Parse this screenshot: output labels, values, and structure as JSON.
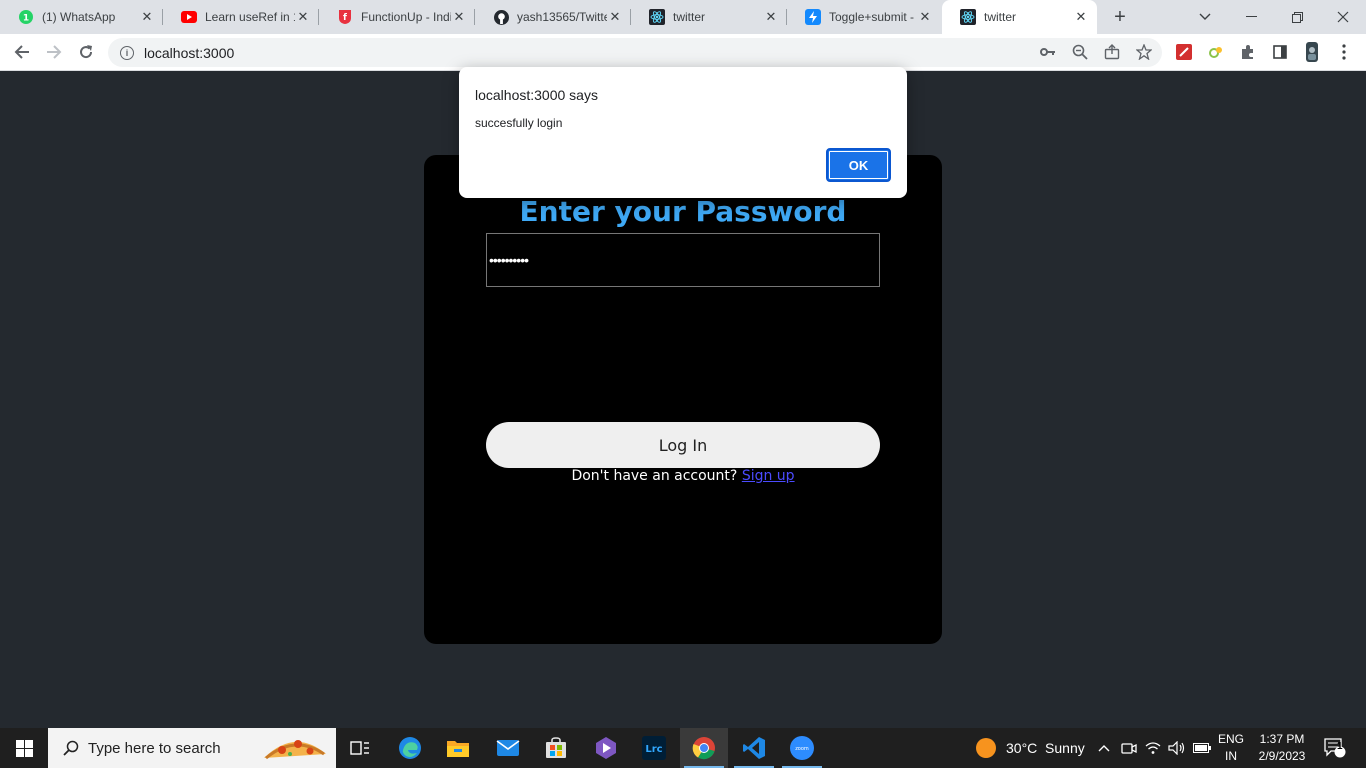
{
  "browser": {
    "tabs": [
      {
        "title": "(1) WhatsApp",
        "icon": "whatsapp-icon",
        "active": false
      },
      {
        "title": "Learn useRef in 1",
        "icon": "youtube-icon",
        "active": false
      },
      {
        "title": "FunctionUp - Indi",
        "icon": "functionup-icon",
        "active": false
      },
      {
        "title": "yash13565/Twitte",
        "icon": "github-icon",
        "active": false
      },
      {
        "title": "twitter",
        "icon": "react-icon",
        "active": false
      },
      {
        "title": "Toggle+submit -",
        "icon": "bolt-icon",
        "active": false
      },
      {
        "title": "twitter",
        "icon": "react-icon",
        "active": true
      }
    ],
    "url": "localhost:3000"
  },
  "alert": {
    "origin": "localhost:3000 says",
    "message": "succesfully login",
    "ok_label": "OK"
  },
  "page": {
    "heading": "Enter your Password",
    "password_masked": "••••••••••",
    "login_label": "Log In",
    "signup_prompt": "Don't have an account?",
    "signup_link": "Sign up",
    "colors": {
      "heading": "#3fa9f5",
      "background": "#24292f",
      "card": "#000000",
      "link": "#4b4bff"
    }
  },
  "taskbar": {
    "search_placeholder": "Type here to search",
    "weather": "30°C  Sunny",
    "lang_top": "ENG",
    "lang_bottom": "IN",
    "time": "1:37 PM",
    "date": "2/9/2023",
    "notification_count": "1"
  }
}
